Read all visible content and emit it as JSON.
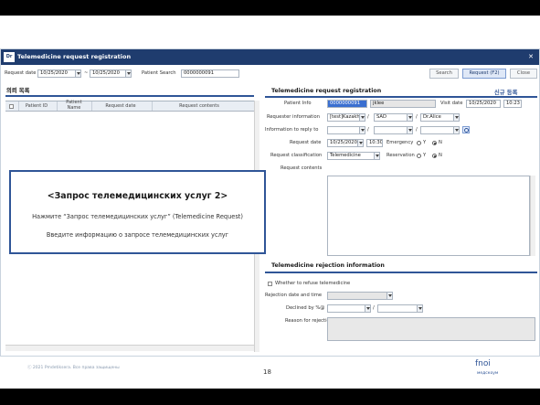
{
  "window": {
    "logo": "Dr",
    "title": "Telemedicine request registration",
    "close": "✕"
  },
  "toolbar": {
    "request_date_label": "Request date",
    "date_from": "10/25/2020",
    "tilde": "~",
    "date_to": "10/25/2020",
    "patient_search_label": "Patient Search",
    "patient_search_value": "0000000091",
    "search_button": "Search",
    "request_button": "Request (F2)",
    "close_button": "Close"
  },
  "left_panel": {
    "title": "의뢰 목록",
    "columns": [
      "Patient ID",
      "Patient Name",
      "Request date",
      "Request contents"
    ]
  },
  "request_form": {
    "title": "Telemedicine request registration",
    "new_link": "신규 등록",
    "patient_info_label": "Patient Info",
    "patient_id": "0000000091",
    "patient_name": "jklee",
    "visit_date_label": "Visit date",
    "visit_date": "10/25/2020",
    "visit_time": "10:23",
    "requester_label": "Requester information",
    "requester_org": "[test]Kazakhs",
    "requester_dept": "SAD",
    "requester_doctor": "Dr.Alice",
    "slash": "/",
    "reply_label": "Information to reply to",
    "request_date_label": "Request date",
    "request_date": "10/25/2020",
    "request_time": "10:30",
    "emergency_label": "Emergency",
    "y_label": "Y",
    "n_label": "N",
    "classification_label": "Request classification",
    "classification": "Telemedicine",
    "reservation_label": "Reservation",
    "contents_label": "Request contents"
  },
  "rejection": {
    "title": "Telemedicine rejection information",
    "whether_label": "Whether to refuse telemedicine",
    "date_time_label": "Rejection date and time",
    "declined_label": "Declined by %@",
    "reason_label": "Reason for rejection"
  },
  "overlay": {
    "title": "<Запрос телемедицинских услуг 2>",
    "line1": "Нажмите “Запрос телемедицинских услуг” (Telemedicine Request) ",
    "line2": "Введите информацию о запросе телемедицинских услуг"
  },
  "footer": {
    "copyright": "ⓒ 2021 Pmdetiksera. Все права защищены",
    "page": "18",
    "brand": "fnoi",
    "brand_sub": "медскоум"
  }
}
